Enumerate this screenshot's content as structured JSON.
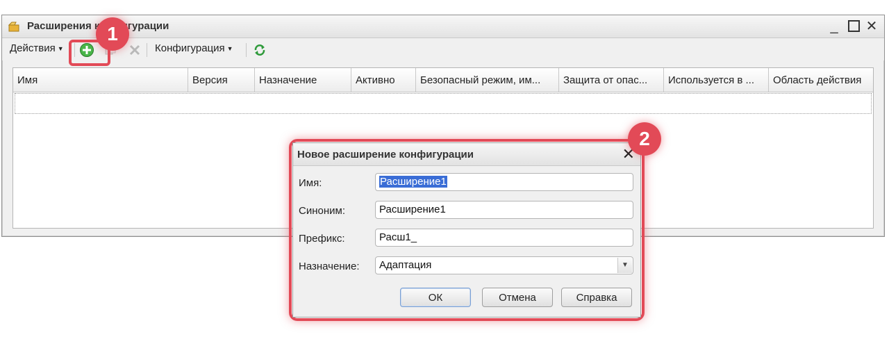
{
  "window": {
    "title": "Расширения конфигурации",
    "controls": {
      "minimize": "_",
      "close": "✕"
    }
  },
  "toolbar": {
    "actions_label": "Действия",
    "config_label": "Конфигурация",
    "icons": [
      "add-icon",
      "copy-icon",
      "delete-icon",
      "refresh-icon"
    ]
  },
  "table": {
    "columns": [
      "Имя",
      "Версия",
      "Назначение",
      "Активно",
      "Безопасный режим, им...",
      "Защита от опас...",
      "Используется в ...",
      "Область действия"
    ],
    "rows": []
  },
  "dialog": {
    "title": "Новое расширение конфигурации",
    "close": "✕",
    "fields": {
      "name_label": "Имя:",
      "name_value": "Расширение1",
      "synonym_label": "Синоним:",
      "synonym_value": "Расширение1",
      "prefix_label": "Префикс:",
      "prefix_value": "Расш1_",
      "purpose_label": "Назначение:",
      "purpose_value": "Адаптация"
    },
    "buttons": {
      "ok": "ОК",
      "cancel": "Отмена",
      "help": "Справка"
    }
  },
  "callouts": {
    "one": "1",
    "two": "2"
  },
  "colors": {
    "callout": "#e24a57",
    "selection": "#3a6dd6",
    "add_icon": "#3aa53a"
  }
}
